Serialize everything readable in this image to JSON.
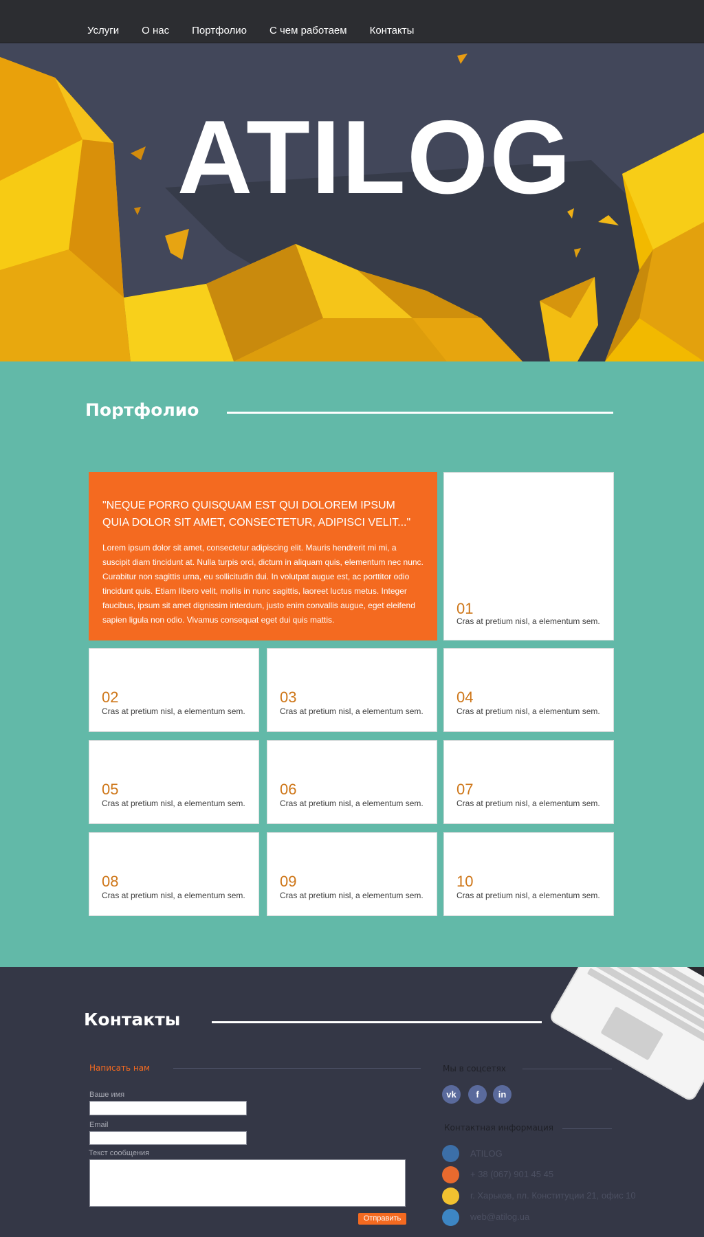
{
  "nav": {
    "items": [
      "Услуги",
      "О нас",
      "Портфолио",
      "С чем работаем",
      "Контакты"
    ]
  },
  "hero": {
    "title": "ATILOG"
  },
  "portfolio": {
    "title": "Портфолио",
    "quote_heading": "\"NEQUE PORRO QUISQUAM EST QUI DOLOREM IPSUM QUIA DOLOR SIT AMET, CONSECTETUR, ADIPISCI VELIT...\"",
    "quote_body": "Lorem ipsum dolor sit amet, consectetur adipiscing elit. Mauris hendrerit mi mi, a suscipit diam tincidunt at. Nulla turpis orci, dictum in aliquam quis, elementum nec nunc. Curabitur non sagittis urna, eu sollicitudin dui. In volutpat augue est, ac porttitor odio tincidunt quis. Etiam libero velit, mollis in nunc sagittis, laoreet luctus metus. Integer faucibus, ipsum sit amet dignissim interdum, justo enim convallis augue, eget eleifend sapien ligula non odio. Vivamus consequat eget dui quis mattis.",
    "items": [
      {
        "num": "01",
        "caption": "Cras at pretium nisl, a elementum sem."
      },
      {
        "num": "02",
        "caption": "Cras at pretium nisl, a elementum sem."
      },
      {
        "num": "03",
        "caption": "Cras at pretium nisl, a elementum sem."
      },
      {
        "num": "04",
        "caption": "Cras at pretium nisl, a elementum sem."
      },
      {
        "num": "05",
        "caption": "Cras at pretium nisl, a elementum sem."
      },
      {
        "num": "06",
        "caption": "Cras at pretium nisl, a elementum sem."
      },
      {
        "num": "07",
        "caption": "Cras at pretium nisl, a elementum sem."
      },
      {
        "num": "08",
        "caption": "Cras at pretium nisl, a elementum sem."
      },
      {
        "num": "09",
        "caption": "Cras at pretium nisl, a elementum sem."
      },
      {
        "num": "10",
        "caption": "Cras at pretium nisl, a elementum sem."
      }
    ]
  },
  "contacts": {
    "title": "Контакты",
    "form": {
      "title": "Написать нам",
      "name_label": "Ваше имя",
      "email_label": "Email",
      "message_label": "Текст сообщения",
      "send_label": "Отправить"
    },
    "social": {
      "title": "Мы в соцсетях",
      "items": [
        {
          "icon": "vk-icon",
          "glyph": "vk"
        },
        {
          "icon": "facebook-icon",
          "glyph": "f"
        },
        {
          "icon": "linkedin-icon",
          "glyph": "in"
        }
      ]
    },
    "info": {
      "title": "Контактная информация",
      "company": "ATILOG",
      "phone": "+ 38 (067) 901 45 45",
      "address": "г. Харьков, пл. Конституции 21, офис 10",
      "email": "web@atilog.ua"
    }
  },
  "colors": {
    "accent": "#f46a20",
    "teal": "#62b9a8",
    "dark": "#343746",
    "nav": "#2c2d31",
    "number": "#ce7618"
  }
}
